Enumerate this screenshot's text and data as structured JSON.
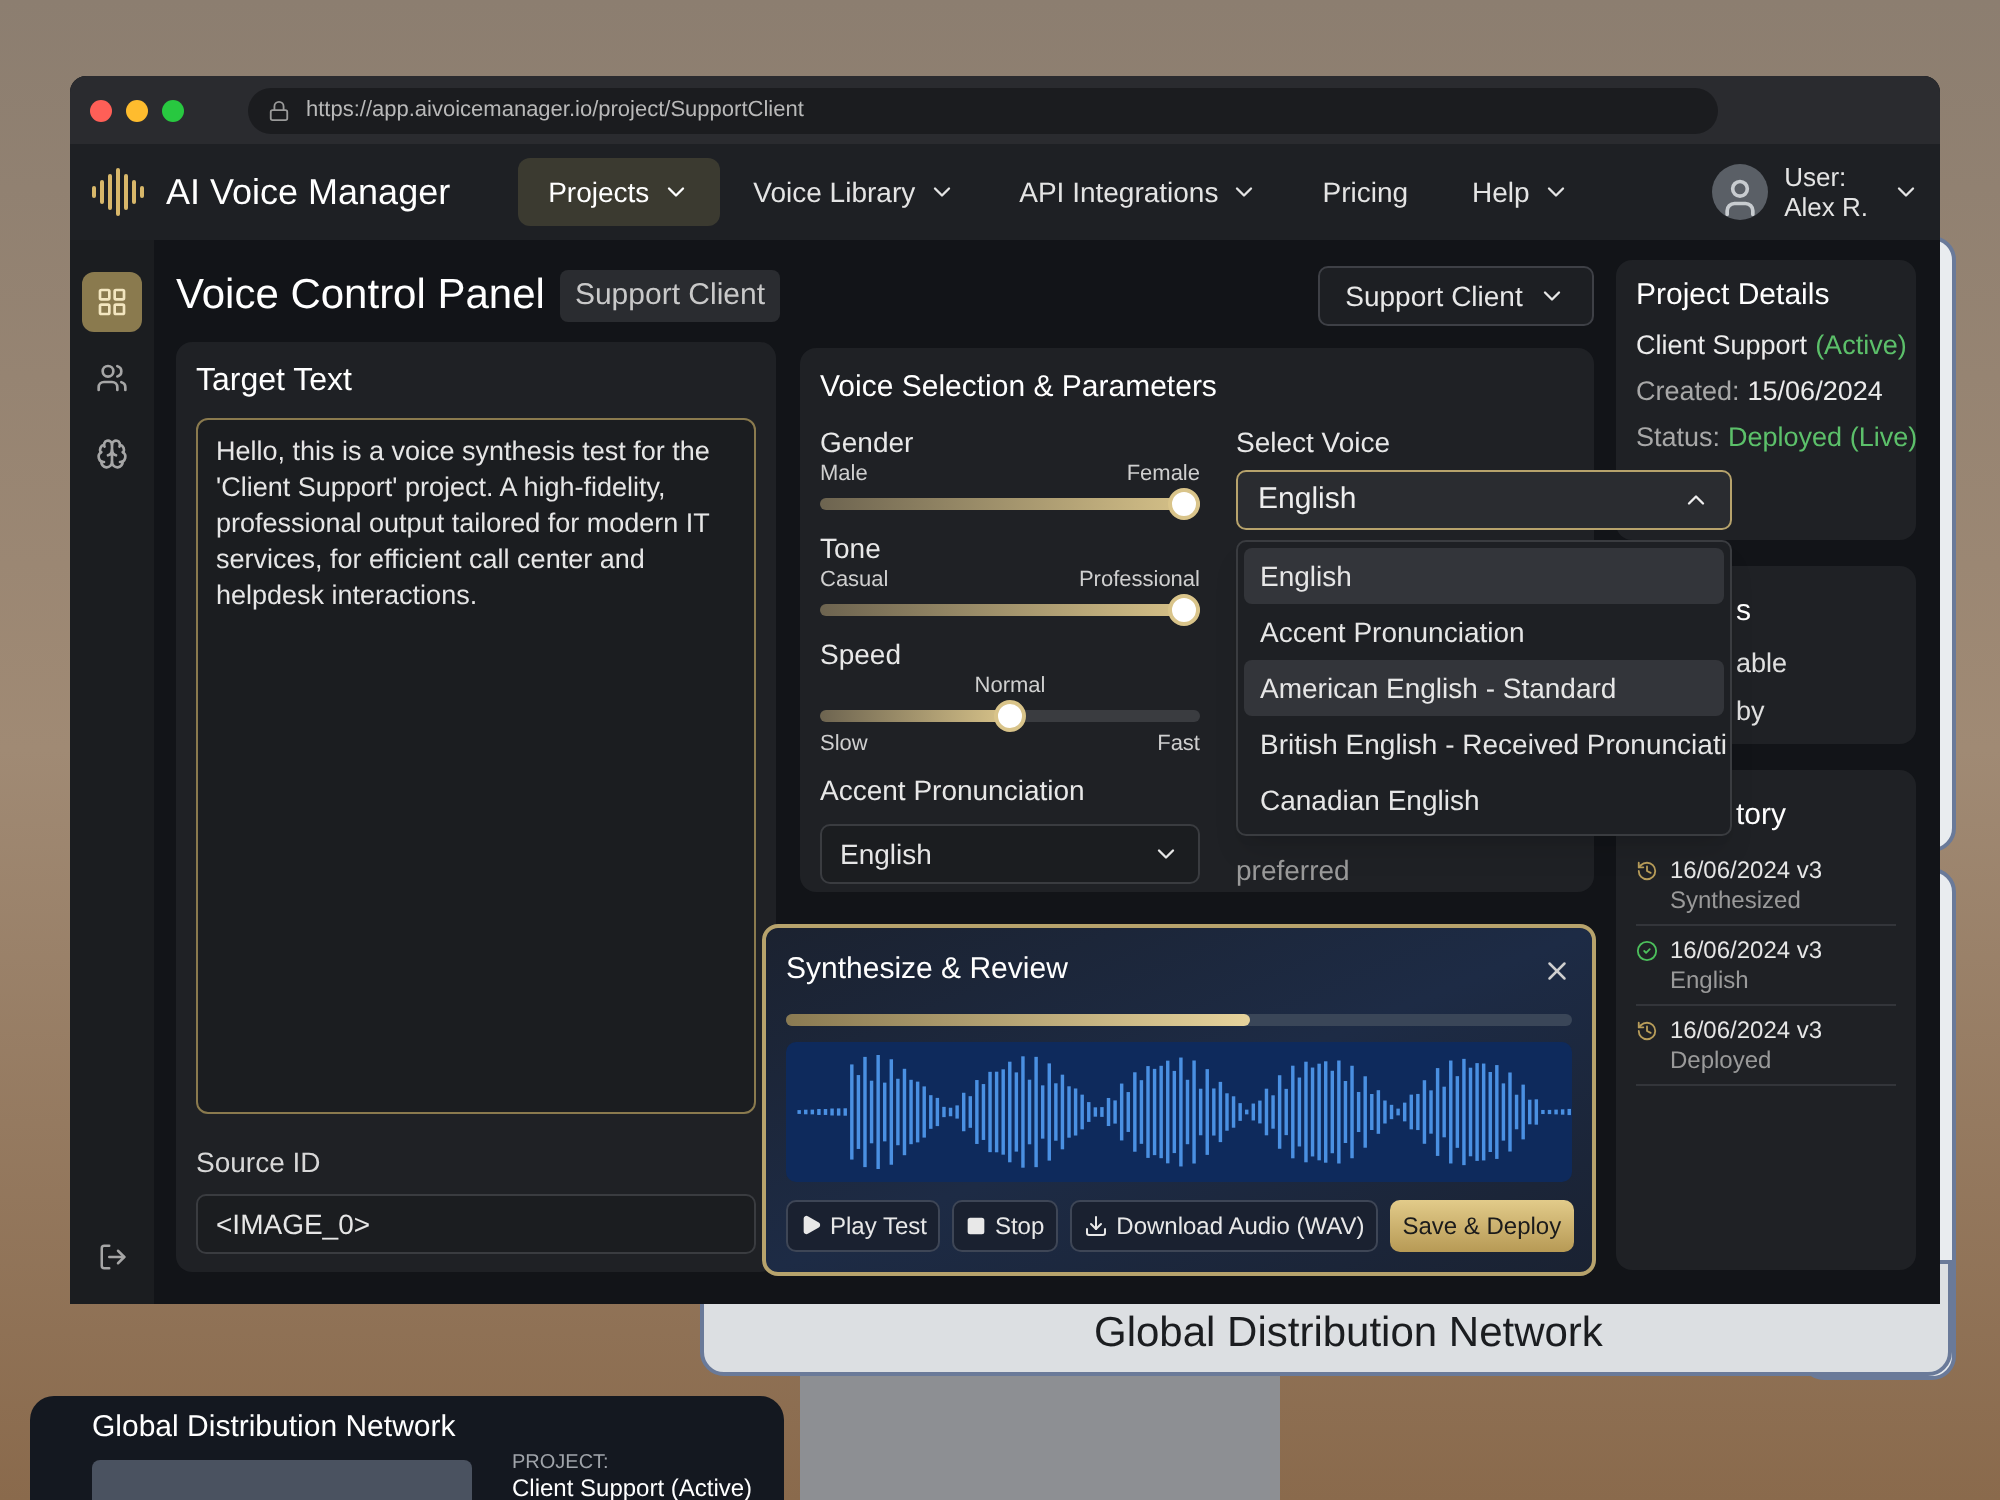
{
  "browser": {
    "url": "https://app.aivoicemanager.io/project/SupportClient"
  },
  "app": {
    "name": "AI Voice Manager"
  },
  "nav": [
    {
      "label": "Projects",
      "selected": true,
      "dropdown": true
    },
    {
      "label": "Voice Library",
      "selected": false,
      "dropdown": true
    },
    {
      "label": "API Integrations",
      "selected": false,
      "dropdown": true
    },
    {
      "label": "Pricing",
      "selected": false,
      "dropdown": false
    },
    {
      "label": "Help",
      "selected": false,
      "dropdown": true
    }
  ],
  "user": {
    "label": "User:",
    "name": "Alex R."
  },
  "sidebar": {
    "items": [
      {
        "kind": "grid",
        "selected": true
      },
      {
        "kind": "users",
        "selected": false
      },
      {
        "kind": "brain",
        "selected": false
      }
    ],
    "bottom": {
      "kind": "logout"
    }
  },
  "page": {
    "title": "Voice Control Panel",
    "badge": "Support Client",
    "project_select": "Support Client"
  },
  "target_text": {
    "title": "Target Text",
    "text": "Hello, this is a voice synthesis test for the 'Client Support' project. A high-fidelity, professional output tailored for modern IT services, for efficient call center and helpdesk interactions.",
    "source_label": "Source ID",
    "source_value": "<IMAGE_0>"
  },
  "voice": {
    "title": "Voice Selection & Parameters",
    "sliders": [
      {
        "label": "Gender",
        "min": "Male",
        "max": "Female",
        "level": 1.0
      },
      {
        "label": "Tone",
        "min": "Casual",
        "max": "Professional",
        "level": 1.0
      },
      {
        "label": "Speed",
        "min": "Slow",
        "max": "Fast",
        "mid": "Normal",
        "level": 0.5
      }
    ],
    "accent": {
      "label": "Accent Pronunciation",
      "value": "English"
    },
    "select_voice": {
      "label": "Select Voice",
      "value": "English",
      "expanded": true,
      "options": [
        {
          "label": "English",
          "highlighted": true
        },
        {
          "label": "Accent Pronunciation",
          "highlighted": false
        },
        {
          "label": "American English - Standard",
          "highlighted": true
        },
        {
          "label": "British English - Received Pronunciati",
          "highlighted": false
        },
        {
          "label": "Canadian English",
          "highlighted": false
        }
      ]
    },
    "hint": "preferred"
  },
  "synth": {
    "title": "Synthesize & Review",
    "level": 0.59,
    "buttons": [
      {
        "label": "Play Test",
        "kind": "play"
      },
      {
        "label": "Stop",
        "kind": "stop"
      },
      {
        "label": "Download Audio (WAV)",
        "kind": "download"
      },
      {
        "label": "Save & Deploy",
        "kind": "primary"
      }
    ]
  },
  "details": {
    "title": "Project Details",
    "rows": [
      {
        "label": "Client Support",
        "label_dim": false,
        "value": "(Active)",
        "highlight": true
      },
      {
        "label": "Created:",
        "label_dim": true,
        "value": "15/06/2024",
        "highlight": false
      },
      {
        "label": "Status:",
        "label_dim": true,
        "value": "Deployed (Live)",
        "highlight": true
      }
    ]
  },
  "card2": {
    "title": "s",
    "lines": [
      "able",
      "by"
    ]
  },
  "history": {
    "title": "tory",
    "items": [
      {
        "date": "16/06/2024 v3",
        "note": "Synthesized",
        "kind": "pending"
      },
      {
        "date": "16/06/2024 v3",
        "note": "English",
        "kind": "done"
      },
      {
        "date": "16/06/2024 v3",
        "note": "Deployed",
        "kind": "pending"
      }
    ]
  },
  "monitor": {
    "caption": "Global Distribution Network"
  },
  "overlay_card": {
    "title": "Global Distribution Network",
    "project_label": "PROJECT:",
    "project_value": "Client Support (Active)"
  }
}
